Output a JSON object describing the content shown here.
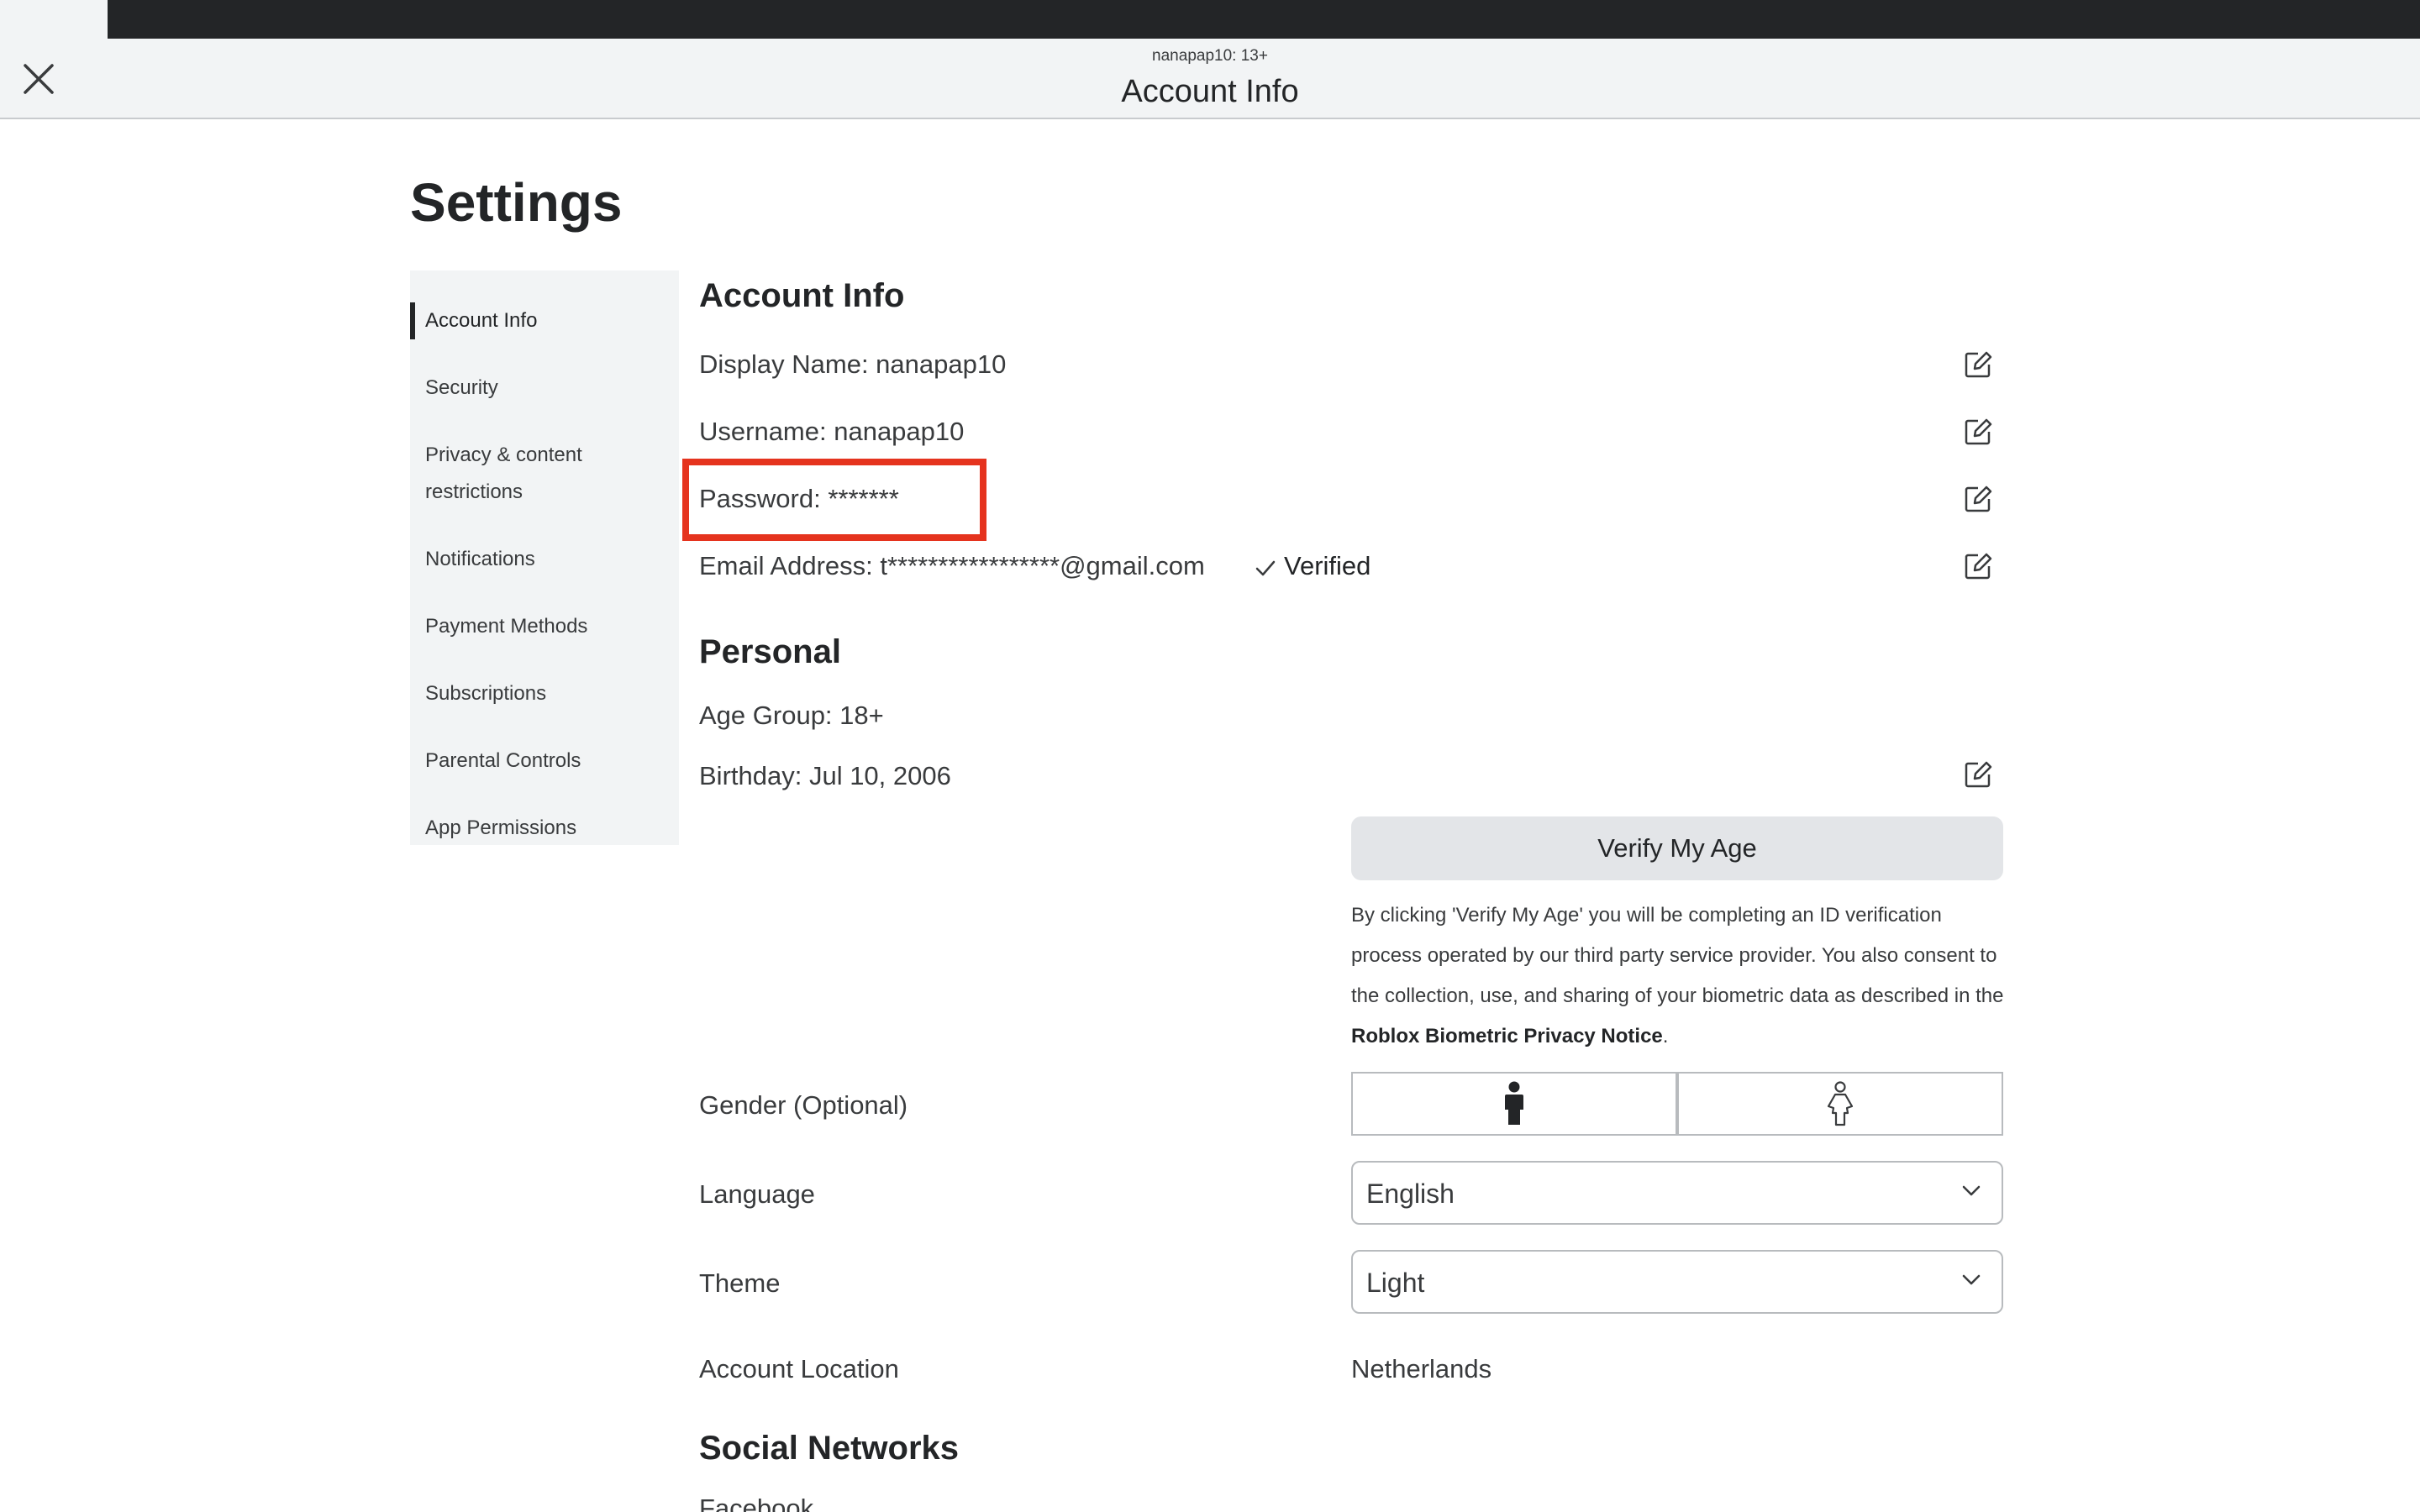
{
  "header": {
    "subtitle": "nanapap10: 13+",
    "title": "Account Info"
  },
  "page_title": "Settings",
  "sidebar": {
    "items": [
      {
        "label": "Account Info"
      },
      {
        "label": "Security"
      },
      {
        "label": "Privacy & content"
      },
      {
        "label": "restrictions"
      },
      {
        "label": "Notifications"
      },
      {
        "label": "Payment Methods"
      },
      {
        "label": "Subscriptions"
      },
      {
        "label": "Parental Controls"
      },
      {
        "label": "App Permissions"
      }
    ]
  },
  "account": {
    "heading": "Account Info",
    "display_name": "Display Name: nanapap10",
    "username": "Username: nanapap10",
    "password": "Password: *******",
    "email": "Email Address: t*****************@gmail.com",
    "verified": "Verified"
  },
  "personal": {
    "heading": "Personal",
    "age_group": "Age Group: 18+",
    "birthday": "Birthday: Jul 10, 2006",
    "verify_button": "Verify My Age",
    "disclaimer_text": "By clicking 'Verify My Age' you will be completing an ID verification process operated by our third party service provider. You also consent to the collection, use, and sharing of your biometric data as described in the ",
    "disclaimer_link": "Roblox Biometric Privacy Notice",
    "disclaimer_end": ".",
    "gender_label": "Gender (Optional)",
    "language_label": "Language",
    "language_value": "English",
    "theme_label": "Theme",
    "theme_value": "Light",
    "location_label": "Account Location",
    "location_value": "Netherlands"
  },
  "social": {
    "heading": "Social Networks",
    "facebook": "Facebook"
  },
  "colors": {
    "highlight": "#e5331e",
    "header_bg": "#f2f4f5",
    "sidebar_bg": "#f2f4f5"
  }
}
